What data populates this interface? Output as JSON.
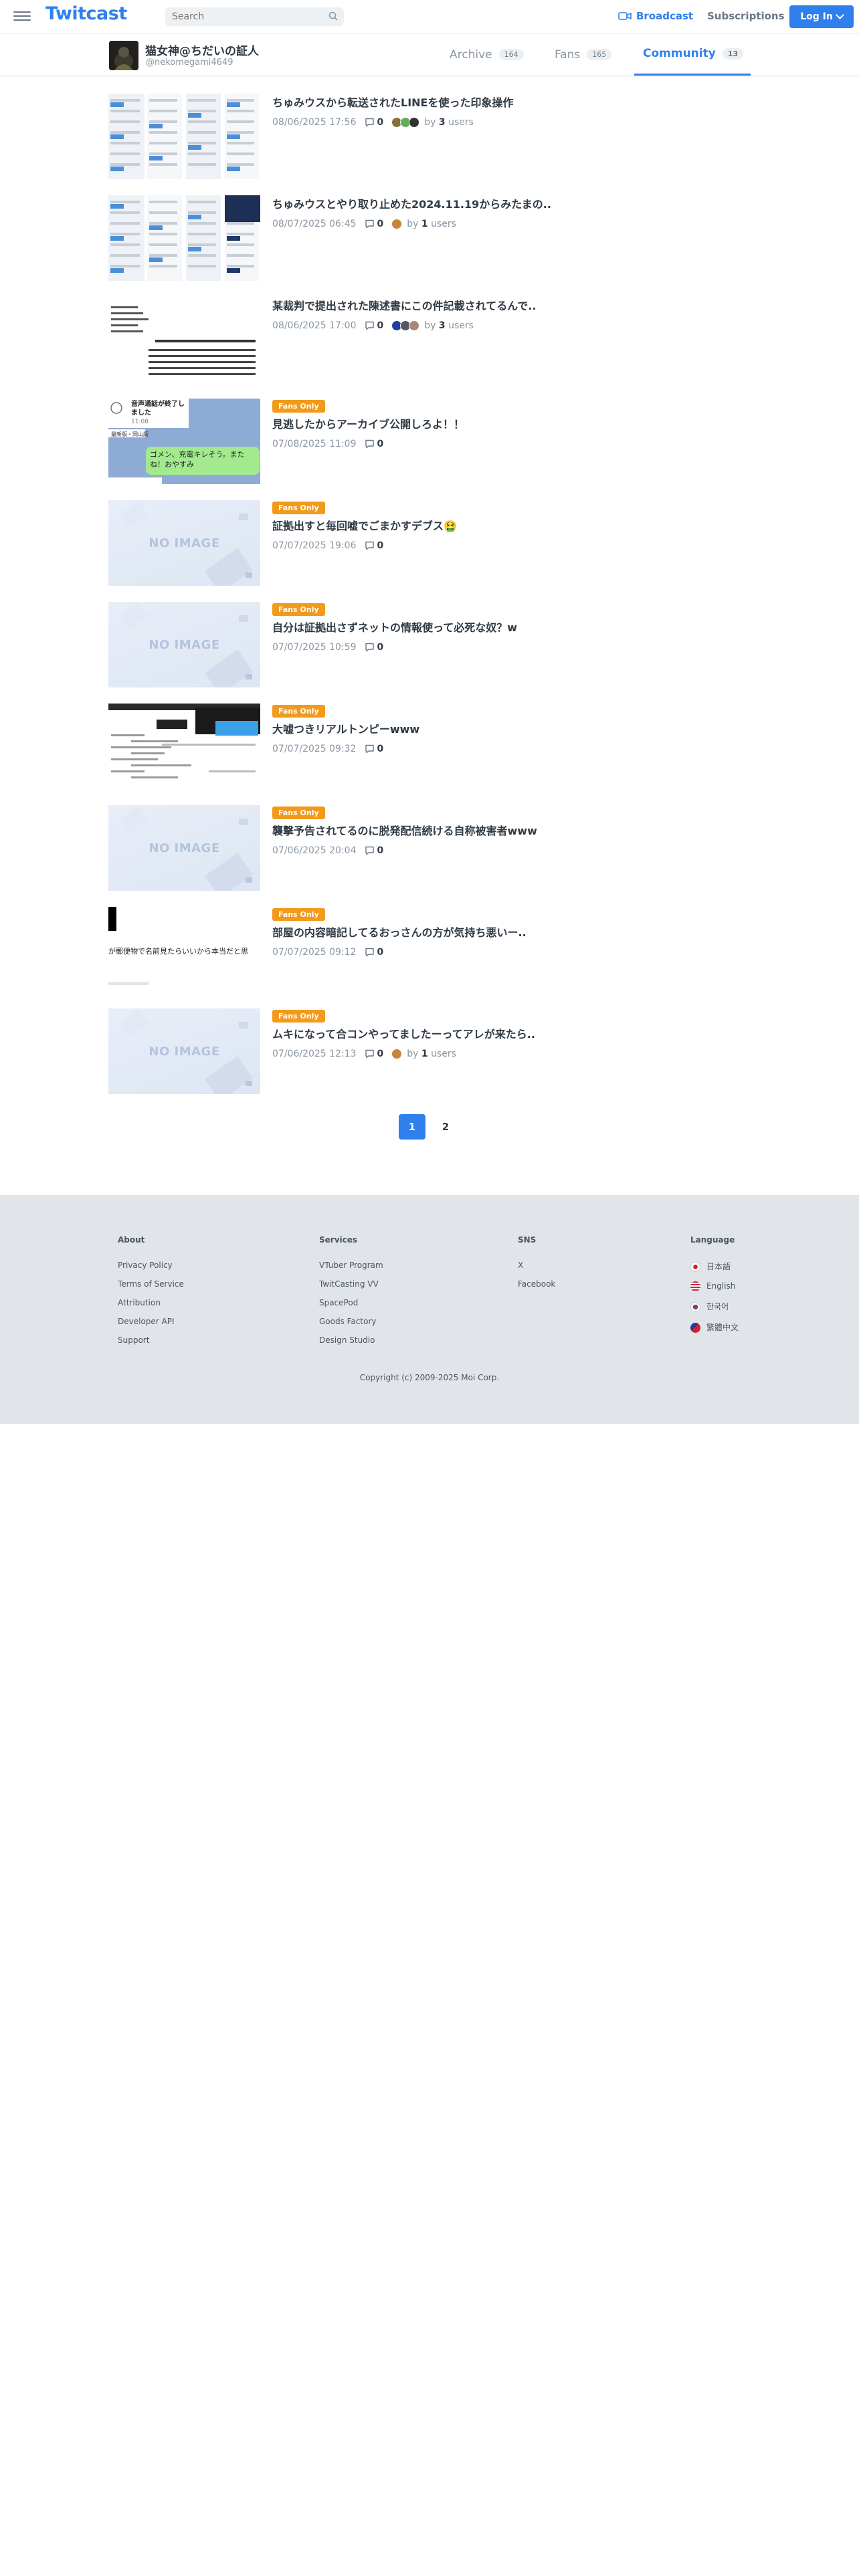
{
  "header": {
    "logo": "Twitcast",
    "search_placeholder": "Search",
    "broadcast": "Broadcast",
    "subscriptions": "Subscriptions",
    "login": "Log In"
  },
  "profile": {
    "name": "猫女神@ちだいの証人",
    "id": "@nekomegami4649",
    "tabs": [
      {
        "label": "Archive",
        "count": "164"
      },
      {
        "label": "Fans",
        "count": "165"
      },
      {
        "label": "Community",
        "count": "13"
      }
    ]
  },
  "items": [
    {
      "title": "ちゅみウスから転送されたLINEを使った印象操作",
      "date": "08/06/2025 17:56",
      "comments": "0",
      "by_prefix": "by",
      "users": "3",
      "users_suffix": "users",
      "badge": "",
      "thumb": "screens"
    },
    {
      "title": "ちゅみウスとやり取り止めた2024.11.19からみたまの..",
      "date": "08/07/2025 06:45",
      "comments": "0",
      "by_prefix": "by",
      "users": "1",
      "users_suffix": "users",
      "badge": "",
      "thumb": "screens2"
    },
    {
      "title": "某裁判で提出された陳述書にこの件記載されてるんで..",
      "date": "08/06/2025 17:00",
      "comments": "0",
      "by_prefix": "by",
      "users": "3",
      "users_suffix": "users",
      "badge": "",
      "thumb": "doc"
    },
    {
      "title": "見逃したからアーカイブ公開しろよ！！",
      "date": "07/08/2025 11:09",
      "comments": "0",
      "badge": "Fans Only",
      "thumb": "line",
      "line_call": "音声通話が終了しました",
      "line_time": "11:08",
      "line_msg": "ゴメン、充電キレそう。またね！おやすみ",
      "line_name": "最新版・岡山版"
    },
    {
      "title": "証拠出すと毎回嘘でごまかすデブス🤮",
      "date": "07/07/2025 19:06",
      "comments": "0",
      "badge": "Fans Only",
      "thumb": "noimage"
    },
    {
      "title": "自分は証拠出さずネットの情報使って必死な奴？w",
      "date": "07/07/2025 10:59",
      "comments": "0",
      "badge": "Fans Only",
      "thumb": "noimage"
    },
    {
      "title": "大嘘つきリアルトンピーwww",
      "date": "07/07/2025 09:32",
      "comments": "0",
      "badge": "Fans Only",
      "thumb": "chat"
    },
    {
      "title": "襲撃予告されてるのに脱発配信続ける自称被害者www",
      "date": "07/06/2025 20:04",
      "comments": "0",
      "badge": "Fans Only",
      "thumb": "noimage"
    },
    {
      "title": "部屋の内容暗記してるおっさんの方が気持ち悪いー..",
      "date": "07/07/2025 09:12",
      "comments": "0",
      "badge": "Fans Only",
      "thumb": "text",
      "thumb_text": "が郵便物で名前見たらいいから本当だと思"
    },
    {
      "title": "ムキになって合コンやってましたーってアレが来たら..",
      "date": "07/06/2025 12:13",
      "comments": "0",
      "by_prefix": "by",
      "users": "1",
      "users_suffix": "users",
      "badge": "Fans Only",
      "thumb": "noimage"
    }
  ],
  "noimage_label": "NO IMAGE",
  "pagination": [
    "1",
    "2"
  ],
  "footer": {
    "about": {
      "heading": "About",
      "links": [
        "Privacy Policy",
        "Terms of Service",
        "Attribution",
        "Developer API",
        "Support"
      ]
    },
    "services": {
      "heading": "Services",
      "links": [
        "VTuber Program",
        "TwitCasting VV",
        "SpacePod",
        "Goods Factory",
        "Design Studio"
      ]
    },
    "sns": {
      "heading": "SNS",
      "links": [
        "X",
        "Facebook"
      ]
    },
    "language": {
      "heading": "Language",
      "links": [
        "日本語",
        "English",
        "한국어",
        "繁體中文"
      ]
    },
    "copyright": "Copyright (c) 2009-2025 Moi Corp."
  },
  "colors": {
    "accent": "#2f80ed",
    "badge": "#f29a1b",
    "footer_bg": "#e1e5e9"
  }
}
